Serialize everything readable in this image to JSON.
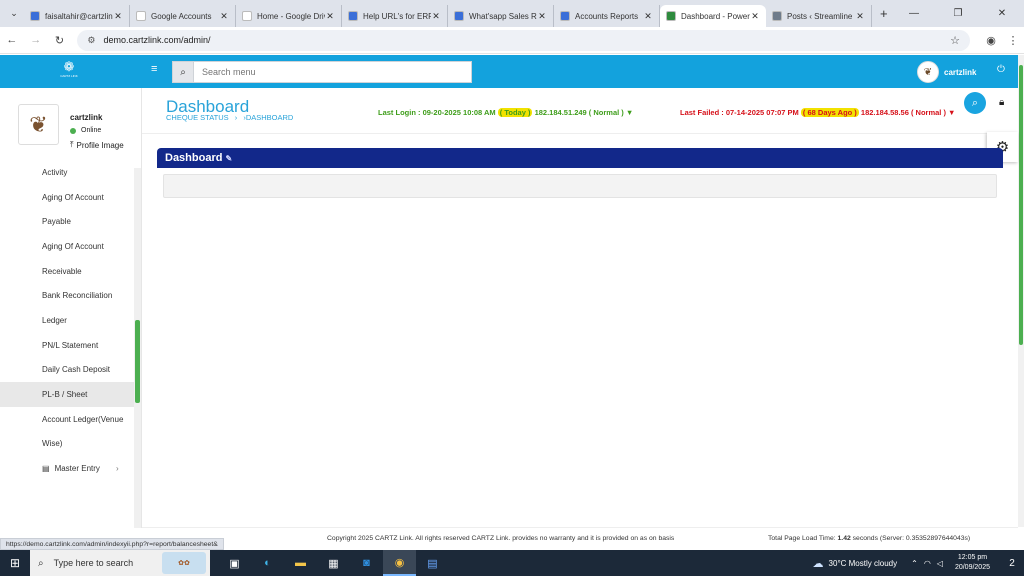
{
  "browser": {
    "tabs": [
      {
        "title": "faisaltahir@cartzlink",
        "icon": "gmail-icon",
        "color": "#3b6fd8"
      },
      {
        "title": "Google Accounts",
        "icon": "google-icon",
        "color": "#ffffff"
      },
      {
        "title": "Home - Google Drive",
        "icon": "drive-icon",
        "color": "#ffffff"
      },
      {
        "title": "Help URL's for ERP",
        "icon": "docs-icon",
        "color": "#3b6fd8"
      },
      {
        "title": "What'sapp Sales Report",
        "icon": "docs-icon",
        "color": "#3b6fd8"
      },
      {
        "title": "Accounts Reports",
        "icon": "docs-icon",
        "color": "#3b6fd8"
      },
      {
        "title": "Dashboard - Power",
        "icon": "site-icon",
        "color": "#2e8b3e",
        "active": true
      },
      {
        "title": "Posts ‹ Streamline",
        "icon": "wordpress-icon",
        "color": "#6e7b8a"
      }
    ],
    "new_tab": "+",
    "url": "demo.cartzlink.com/admin/"
  },
  "header": {
    "logo_text": "CARTZ LINK",
    "search_placeholder": "Search menu",
    "user_name": "cartzlink"
  },
  "sidebar": {
    "profile_name": "cartzlink",
    "status": "Online",
    "profile_link": "Profile Image",
    "items": [
      {
        "label": "Activity"
      },
      {
        "label": "Aging Of Account"
      },
      {
        "label": "Payable"
      },
      {
        "label": "Aging Of Account"
      },
      {
        "label": "Receivable"
      },
      {
        "label": "Bank Reconciliation"
      },
      {
        "label": "Ledger"
      },
      {
        "label": "PN/L Statement"
      },
      {
        "label": "Daily Cash Deposit"
      },
      {
        "label": "PL-B / Sheet",
        "active": true
      },
      {
        "label": "Account Ledger(Venue"
      },
      {
        "label": "Wise)"
      }
    ],
    "master_entry": "Master Entry"
  },
  "page": {
    "title": "Dashboard",
    "breadcrumb": [
      "CHEQUE STATUS",
      "›",
      "›DASHBOARD"
    ],
    "last_login": {
      "prefix": "Last Login : 09-20-2025 10:08 AM",
      "badge": "( Today )",
      "suffix": "182.184.51.249 ( Normal ) ▼"
    },
    "last_failed": {
      "prefix": "Last Failed : 07-14-2025 07:07 PM",
      "badge": "( 68 Days Ago )",
      "suffix": "182.184.58.56 ( Normal ) ▼"
    },
    "panel_title": "Dashboard"
  },
  "footer": {
    "copyright": "Copyright 2025 CARTZ Link. All rights reserved CARTZ Link. provides no warranty and it is provided on as on basis",
    "load_time_prefix": "Total Page Load Time: ",
    "load_time_value": "1.42",
    "load_time_suffix": " seconds (Server: 0.35352897644043s)",
    "status_url": "https://demo.cartzlink.com/admin/indexyii.php?r=report/balancesheet&"
  },
  "taskbar": {
    "search_placeholder": "Type here to search",
    "weather": "30°C  Mostly cloudy",
    "time": "12:05 pm",
    "date": "20/09/2025",
    "notifications": "2"
  }
}
